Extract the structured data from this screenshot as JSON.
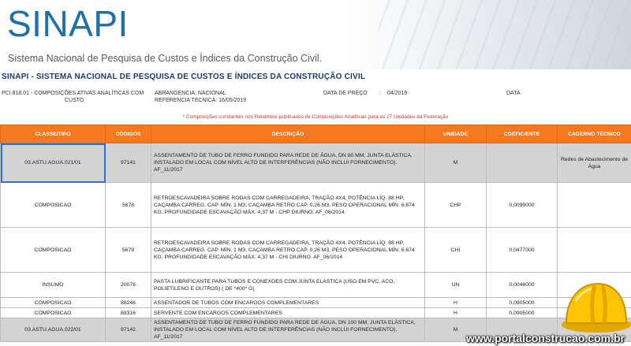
{
  "header": {
    "logo": "SINAPI",
    "subtitle": "Sistema Nacional de Pesquisa de Custos e Índices da Construção Civil."
  },
  "report": {
    "title": "SINAPI - SISTEMA NACIONAL DE PESQUISA DE CUSTOS E ÍNDICES DA CONSTRUÇÃO CIVIL",
    "meta_left": "PCI.818.01 - COMPOSIÇÕES ATIVAS ANALÍTICAS COM",
    "meta_left2": "CUSTO",
    "abrangencia": "ABRANGENCIA: NACIONAL",
    "referencia": "REFERENCIA TECNICA: 16/05/2019",
    "data_preco_label": "DATA DE PREÇO",
    "data_preco_sep": ":",
    "data_preco_value": "04/2019",
    "data_label": "DATA"
  },
  "note": "* Composições constantes nos Relatórios publicados de Composições Analíticas para as 27 Unidades da Federação",
  "table": {
    "headers": [
      "CLASSE/TIPO",
      "CÓDIGOS",
      "DESCRIÇÃO",
      "UNIDADE",
      "COEFICIENTE",
      "CADERNO TÉCNICO"
    ],
    "rows": [
      {
        "classe": "03.ASTU.AGUA.021/01",
        "codigo": "97141",
        "descricao": "ASSENTAMENTO DE TUBO DE FERRO FUNDIDO PARA REDE DE ÁGUA, DN 80 MM, JUNTA ELÁSTICA, INSTALADO EM LOCAL COM NÍVEL ALTO DE INTERFERÊNCIAS (NÃO INCLUI FORNECIMENTO). AF_11/2017",
        "unidade": "M",
        "coeficiente": "",
        "caderno": "Redes de Abastecimento de Água"
      },
      {
        "classe": "COMPOSICAO",
        "codigo": "5678",
        "descricao": "RETROESCAVADEIRA SOBRE RODAS COM CARREGADEIRA, TRAÇÃO 4X4, POTÊNCIA LÍQ. 88 HP, CAÇAMBA CARREG. CAP. MÍN. 1 M3, CAÇAMBA RETRO CAP. 0,26 M3, PESO OPERACIONAL MÍN. 6.674 KG, PROFUNDIDADE ESCAVAÇÃO MÁX. 4,37 M - CHP DIURNO. AF_06/2014",
        "unidade": "CHP",
        "coeficiente": "0,0099000",
        "caderno": ""
      },
      {
        "classe": "COMPOSICAO",
        "codigo": "5679",
        "descricao": "RETROESCAVADEIRA SOBRE RODAS COM CARREGADEIRA, TRAÇÃO 4X4, POTÊNCIA LÍQ. 88 HP, CAÇAMBA CARREG. CAP. MÍN. 1 M3, CAÇAMBA RETRO CAP. 0,26 M3, PESO OPERACIONAL MÍN. 6.674 KG, PROFUNDIDADE ESCAVAÇÃO MÁX. 4,37 M - CHI DIURNO. AF_06/2014",
        "unidade": "CHI",
        "coeficiente": "0,0477000",
        "caderno": ""
      },
      {
        "classe": "INSUMO",
        "codigo": "20078",
        "descricao": "PASTA LUBRIFICANTE PARA TUBOS E CONEXOES COM JUNTA ELASTICA (USO EM PVC, ACO, POLIETILENO E OUTROS) ( DE *400* G)",
        "unidade": "UN",
        "coeficiente": "0,0046000",
        "caderno": ""
      },
      {
        "classe": "COMPOSICAO",
        "codigo": "88246",
        "descricao": "ASSENTADOR DE TUBOS COM ENCARGOS COMPLEMENTARES",
        "unidade": "H",
        "coeficiente": "0,0905000",
        "caderno": ""
      },
      {
        "classe": "COMPOSICAO",
        "codigo": "88316",
        "descricao": "SERVENTE COM ENCARGOS COMPLEMENTARES",
        "unidade": "H",
        "coeficiente": "0,0905000",
        "caderno": ""
      },
      {
        "classe": "03.ASTU.AGUA.022/01",
        "codigo": "97142",
        "descricao": "ASSENTAMENTO DE TUBO DE FERRO FUNDIDO PARA REDE DE ÁGUA, DN 100 MM, JUNTA ELÁSTICA, INSTALADO EM LOCAL COM NÍVEL ALTO DE INTERFERÊNCIAS (NÃO INCLUI FORNECIMENTO). AF_11/2017",
        "unidade": "M",
        "coeficiente": "",
        "caderno": ""
      }
    ]
  },
  "watermark": "www.portalconstrucao.com.br",
  "colors": {
    "header_orange": "#f47920",
    "logo_blue": "#1f6fa8",
    "title_navy": "#1b3a70",
    "note_red": "#d9342b"
  }
}
